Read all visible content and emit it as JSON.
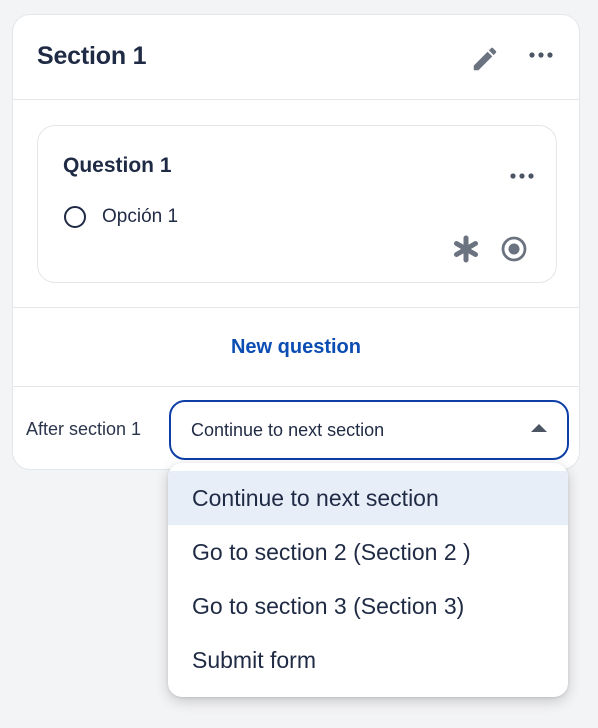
{
  "section": {
    "title": "Section 1",
    "edit_icon": "pencil-icon",
    "more_icon": "more-horizontal-icon"
  },
  "question": {
    "title": "Question 1",
    "option_label": "Opción 1",
    "more_icon": "more-horizontal-icon",
    "required_icon": "asterisk-icon",
    "type_icon": "radio-button-icon"
  },
  "new_question_label": "New question",
  "after_section": {
    "label": "After section 1",
    "selected_value": "Continue to next section"
  },
  "dropdown": {
    "options": [
      "Continue to next section",
      "Go to section 2 (Section 2 )",
      "Go to section 3 (Section 3)",
      "Submit form"
    ]
  },
  "colors": {
    "accent": "#0b4db3",
    "text": "#1f2a44",
    "selected_bg": "#e8eef8",
    "icon_gray": "#6b7280"
  }
}
